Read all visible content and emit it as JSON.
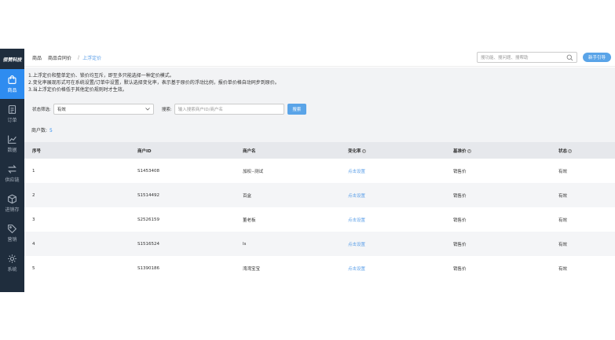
{
  "sidebar": {
    "logo": "很赞科技",
    "items": [
      {
        "label": "商品",
        "icon": "bag-icon",
        "active": true
      },
      {
        "label": "订单",
        "icon": "document-icon"
      },
      {
        "label": "数据",
        "icon": "line-chart-icon"
      },
      {
        "label": "供应链",
        "icon": "swap-icon"
      },
      {
        "label": "进销存",
        "icon": "box-icon"
      },
      {
        "label": "营销",
        "icon": "tag-icon"
      },
      {
        "label": "系统",
        "icon": "gear-icon"
      }
    ]
  },
  "header": {
    "breadcrumb": [
      "商品",
      "商品合同价",
      "上浮定价"
    ],
    "search_placeholder": "搜功能、搜问题、搜帮助",
    "guide_label": "新手引导"
  },
  "notes": [
    "1.上浮定价和整单定价、锁价均互斥，即至多只能选择一种定价模式。",
    "2.变化率展现形式可在系统设置/订单中设置，默认选择变化率，表示基于原价的浮动比例，报价单价格自动同步到原价。",
    "3.当上浮定价价格低于其他定价规则时才生效。"
  ],
  "filter": {
    "status_label": "状态筛选:",
    "status_value": "有效",
    "search_label": "搜索:",
    "search_placeholder": "输入搜索商户ID/商户名",
    "search_button": "搜索"
  },
  "count": {
    "label": "商户数:",
    "value": "5"
  },
  "table": {
    "headers": [
      "序号",
      "商户ID",
      "商户名",
      "变化率",
      "基准价",
      "状态"
    ],
    "rows": [
      {
        "no": "1",
        "id": "S1453408",
        "name": "加权--测试",
        "rate": "点击设置",
        "base": "销售价",
        "status": "有效"
      },
      {
        "no": "2",
        "id": "S1514492",
        "name": "百盒",
        "rate": "点击设置",
        "base": "销售价",
        "status": "有效"
      },
      {
        "no": "3",
        "id": "S2526159",
        "name": "董老板",
        "rate": "点击设置",
        "base": "销售价",
        "status": "有效"
      },
      {
        "no": "4",
        "id": "S1516524",
        "name": "ls",
        "rate": "点击设置",
        "base": "销售价",
        "status": "有效"
      },
      {
        "no": "5",
        "id": "S1390186",
        "name": "湾湾宝宝",
        "rate": "点击设置",
        "base": "销售价",
        "status": "有效"
      }
    ]
  }
}
